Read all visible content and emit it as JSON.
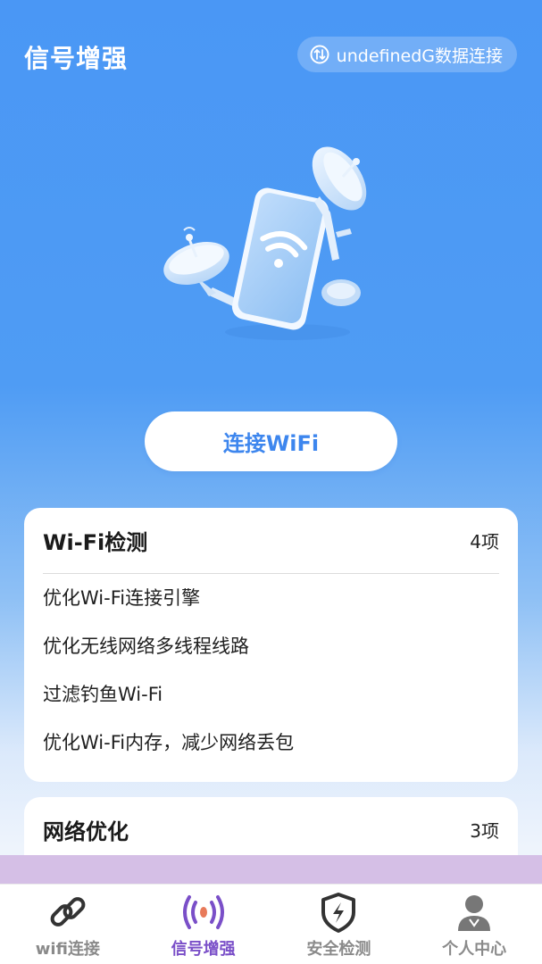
{
  "header": {
    "title": "信号增强",
    "data_status": "undefinedG数据连接",
    "data_icon": "data-transfer-icon"
  },
  "hero": {
    "icon": "phone-wifi-satellite-illustration"
  },
  "connect_button": {
    "label": "连接WiFi"
  },
  "cards": [
    {
      "title": "Wi-Fi检测",
      "count": "4项",
      "items": [
        "优化Wi-Fi连接引擎",
        "优化无线网络多线程线路",
        "过滤钓鱼Wi-Fi",
        "优化Wi-Fi内存，减少网络丢包"
      ]
    },
    {
      "title": "网络优化",
      "count": "3项"
    }
  ],
  "tabbar": {
    "active": 1,
    "tabs": [
      {
        "label": "wifi连接",
        "icon": "link-icon"
      },
      {
        "label": "信号增强",
        "icon": "signal-broadcast-icon"
      },
      {
        "label": "安全检测",
        "icon": "shield-bolt-icon"
      },
      {
        "label": "个人中心",
        "icon": "user-icon"
      }
    ]
  },
  "colors": {
    "accent": "#3d86ee",
    "active_tab": "#7a4fc8",
    "band": "#d5bfe6"
  }
}
